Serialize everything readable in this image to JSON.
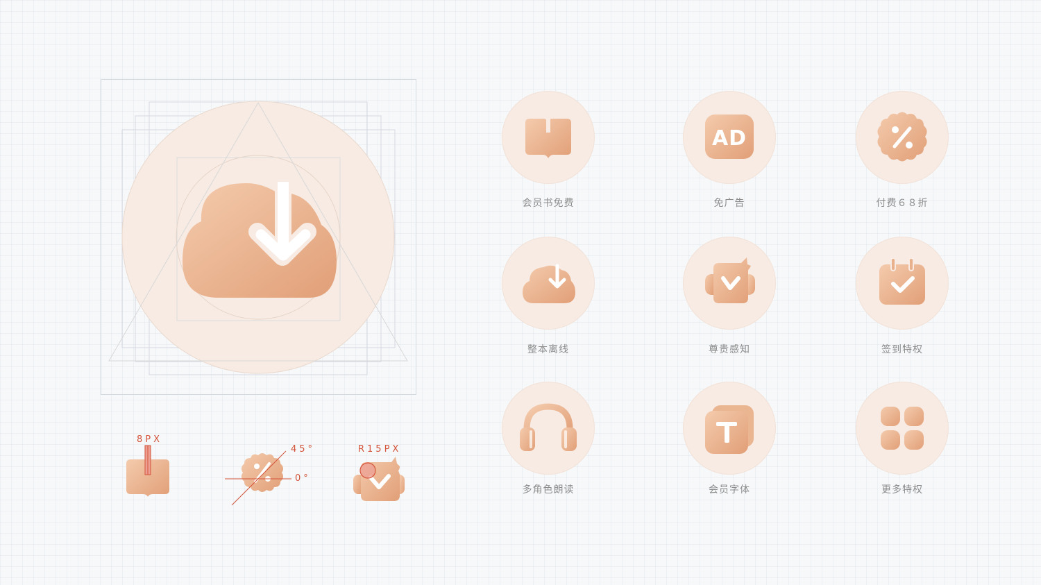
{
  "colors": {
    "icon_gradient_start": "#f3c6a6",
    "icon_gradient_end": "#e4a47d",
    "circle_bg": "#f7ebe3",
    "guide_lines": "#d5d9e0",
    "annotation": "#d4543a",
    "label_text": "#8c8c8c"
  },
  "hero": {
    "icon": "cloud-download-icon"
  },
  "specs": [
    {
      "icon": "book-icon",
      "label": "8PX"
    },
    {
      "icon": "discount-badge-icon",
      "angle_top": "45°",
      "angle_side": "0°"
    },
    {
      "icon": "crown-check-icon",
      "label": "R15PX"
    }
  ],
  "features": [
    {
      "icon": "book-icon",
      "label": "会员书免费"
    },
    {
      "icon": "ad-icon",
      "label": "免广告"
    },
    {
      "icon": "discount-badge-icon",
      "label": "付费６８折"
    },
    {
      "icon": "cloud-download-icon",
      "label": "整本离线"
    },
    {
      "icon": "crown-check-icon",
      "label": "尊贵感知"
    },
    {
      "icon": "calendar-check-icon",
      "label": "签到特权"
    },
    {
      "icon": "headphones-icon",
      "label": "多角色朗读"
    },
    {
      "icon": "font-t-icon",
      "label": "会员字体"
    },
    {
      "icon": "grid-apps-icon",
      "label": "更多特权"
    }
  ]
}
